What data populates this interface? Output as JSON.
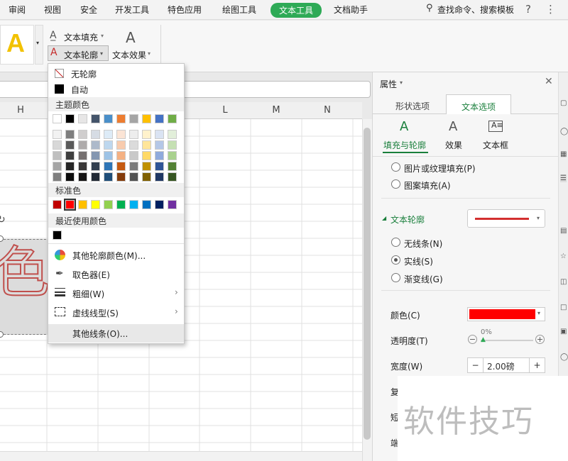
{
  "menubar": {
    "tabs": [
      "审阅",
      "视图",
      "安全",
      "开发工具",
      "特色应用",
      "绘图工具",
      "文本工具",
      "文档助手"
    ],
    "active_tab": "文本工具",
    "search_label": "查找命令、搜索模板",
    "help": "?",
    "more": "⋮"
  },
  "ribbon": {
    "big_letter": "A",
    "text_fill": "文本填充",
    "text_outline": "文本轮廓",
    "text_effect": "文本效果"
  },
  "columns": {
    "h": "H",
    "l": "L",
    "m": "M",
    "n": "N"
  },
  "canvas_char": "色",
  "dropdown": {
    "no_outline": "无轮廓",
    "auto": "自动",
    "theme_title": "主题颜色",
    "standard_title": "标准色",
    "recent_title": "最近使用颜色",
    "more_colors": "其他轮廓颜色(M)...",
    "eyedropper": "取色器(E)",
    "weight": "粗细(W)",
    "dash": "虚线线型(S)",
    "other_lines": "其他线条(O)...",
    "arrow": "›",
    "theme_top": [
      "#ffffff",
      "#000000",
      "#e7e6e6",
      "#44546a",
      "#4a8fc9",
      "#ed7d31",
      "#a5a5a5",
      "#ffc000",
      "#4472c4",
      "#70ad47"
    ],
    "theme_shades": [
      [
        "#f2f2f2",
        "#7f7f7f",
        "#d0cece",
        "#d6dce4",
        "#ddebf7",
        "#fbe4d5",
        "#ededed",
        "#fff2cc",
        "#dae3f3",
        "#e2efda"
      ],
      [
        "#d8d8d8",
        "#595959",
        "#aeabab",
        "#adb9ca",
        "#bdd7ee",
        "#f8cbad",
        "#dbdbdb",
        "#ffe599",
        "#b4c7e7",
        "#c5e0b3"
      ],
      [
        "#bfbfbf",
        "#3f3f3f",
        "#757070",
        "#8496b0",
        "#9dc3e6",
        "#f4b183",
        "#c9c9c9",
        "#ffd966",
        "#8faadc",
        "#a9d18e"
      ],
      [
        "#a5a5a5",
        "#262626",
        "#3a3838",
        "#323f4f",
        "#2e75b6",
        "#c55a11",
        "#7b7b7b",
        "#bf9000",
        "#2f5597",
        "#538135"
      ],
      [
        "#7f7f7f",
        "#0c0c0c",
        "#171616",
        "#222a35",
        "#1f4e79",
        "#843c0c",
        "#525252",
        "#7f6000",
        "#203864",
        "#375623"
      ]
    ],
    "standard": [
      "#c00000",
      "#ff0000",
      "#ffc000",
      "#ffff00",
      "#92d050",
      "#00b050",
      "#00b0f0",
      "#0070c0",
      "#002060",
      "#7030a0"
    ],
    "recent": [
      "#000000"
    ]
  },
  "panel": {
    "title": "属性",
    "tab_shape": "形状选项",
    "tab_text": "文本选项",
    "sub_fill": "填充与轮廓",
    "sub_effect": "效果",
    "sub_box": "文本框",
    "pic_fill": "图片或纹理填充(P)",
    "pattern_fill": "图案填充(A)",
    "outline_section": "文本轮廓",
    "no_line": "无线条(N)",
    "solid": "实线(S)",
    "gradient": "渐变线(G)",
    "color_label": "颜色(C)",
    "transparency_label": "透明度(T)",
    "transparency_value": "0%",
    "width_label": "宽度(W)",
    "width_value": "2.00磅",
    "minus": "−",
    "plus": "+",
    "row_a": "复",
    "row_b": "短",
    "row_c": "端",
    "outline_color": "#d32f2f",
    "color_swatch": "#ff0000"
  },
  "watermark": "软件技巧"
}
